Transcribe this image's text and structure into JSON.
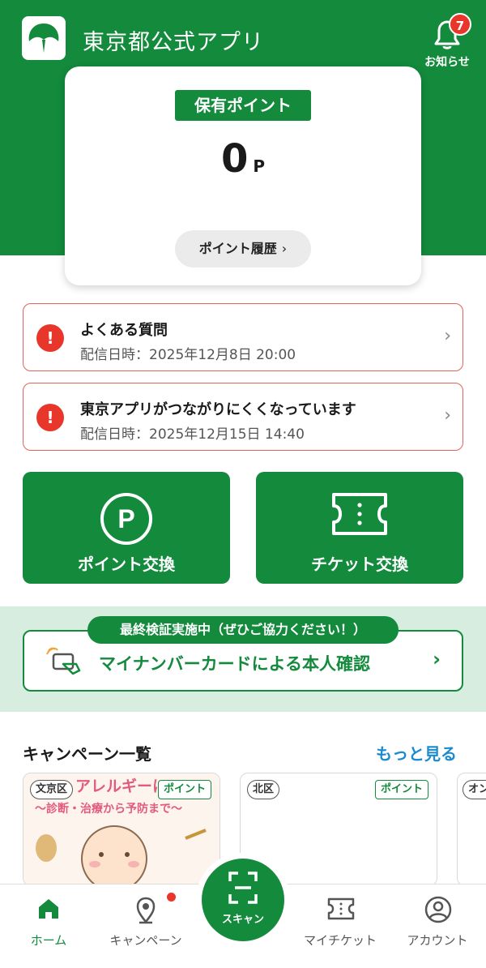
{
  "header": {
    "app_title": "東京都公式アプリ",
    "notifications_label": "お知らせ",
    "notifications_count": "7"
  },
  "points": {
    "tag": "保有ポイント",
    "value": "0",
    "unit": "P",
    "history_label": "ポイント履歴"
  },
  "notices": [
    {
      "title": "よくある質問",
      "date": "配信日時：2025年12月8日 20:00"
    },
    {
      "title": "東京アプリがつながりにくくなっています",
      "date": "配信日時：2025年12月15日 14:40"
    }
  ],
  "actions": {
    "point_exchange": "ポイント交換",
    "ticket_exchange": "チケット交換"
  },
  "mynumber": {
    "tag": "最終検証実施中（ぜひご協力ください！）",
    "label": "マイナンバーカードによる本人確認"
  },
  "campaigns": {
    "title": "キャンペーン一覧",
    "more": "もっと見る",
    "items": [
      {
        "area": "文京区",
        "badge": "ポイント",
        "banner_title": "アレルギーに",
        "banner_sub": "〜診断・治療から予防まで〜"
      },
      {
        "area": "北区",
        "badge": "ポイント"
      },
      {
        "area": "オン"
      }
    ]
  },
  "nav": {
    "home": "ホーム",
    "campaign": "キャンペーン",
    "scan": "スキャン",
    "my_ticket": "マイチケット",
    "account": "アカウント"
  },
  "colors": {
    "brand_green": "#138a3c",
    "alert_red": "#e8362b",
    "link_blue": "#1b8bd0",
    "band_green": "#d6ede0"
  },
  "icons": [
    "tokyo-logo-icon",
    "bell-icon",
    "alert-icon",
    "chevron-right-icon",
    "point-p-icon",
    "ticket-icon",
    "card-scan-icon",
    "home-icon",
    "map-pin-icon",
    "scan-icon",
    "my-ticket-icon",
    "account-icon"
  ]
}
